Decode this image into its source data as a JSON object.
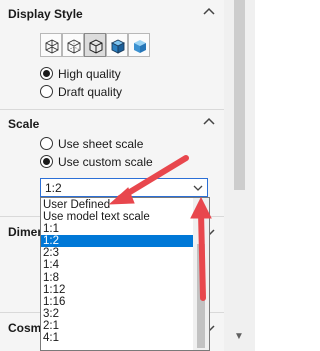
{
  "display_style": {
    "title": "Display Style",
    "buttons": [
      "wireframe-icon",
      "hidden-lines-visible-icon",
      "hidden-lines-removed-icon",
      "shaded-with-edges-icon",
      "shaded-icon"
    ],
    "quality_options": [
      {
        "label": "High quality",
        "checked": true
      },
      {
        "label": "Draft quality",
        "checked": false
      }
    ]
  },
  "scale": {
    "title": "Scale",
    "options": [
      {
        "label": "Use sheet scale",
        "checked": false
      },
      {
        "label": "Use custom scale",
        "checked": true
      }
    ],
    "selected_value": "1:2",
    "dropdown_items": [
      "User Defined",
      "Use model text scale",
      "1:1",
      "1:2",
      "2:3",
      "1:4",
      "1:8",
      "1:12",
      "1:16",
      "3:2",
      "2:1",
      "4:1"
    ],
    "selected_index": 3
  },
  "dimension_section": {
    "title": "Dimen"
  },
  "cosmetic_section": {
    "title": "Cosme"
  },
  "colors": {
    "accent": "#0078d7",
    "annotation_arrow": "#e8474d"
  }
}
